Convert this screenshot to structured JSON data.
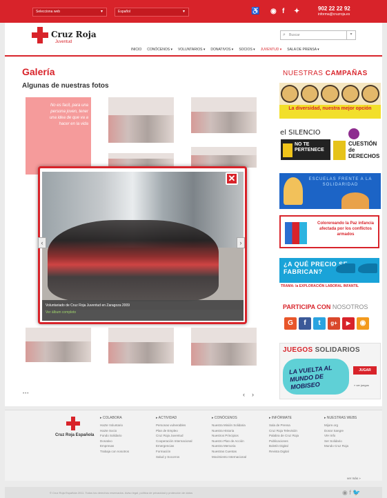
{
  "topbar": {
    "select_site": "Selecciona web",
    "select_lang": "Español",
    "phone": "902 22 22 92",
    "email": "informa@cruzroja.es",
    "icons": [
      "accessibility-icon",
      "rss-icon",
      "facebook-icon",
      "twitter-icon"
    ]
  },
  "header": {
    "brand": "Cruz Roja",
    "brand_sub": "Juventud",
    "search_placeholder": "Buscar",
    "nav": [
      "INICIO",
      "CONÓCENOS ▾",
      "VOLUNTARIOS ▾",
      "DONATIVOS ▾",
      "SOCIOS ▾",
      "JUVENTUD ▾",
      "SALA DE PRENSA ▾"
    ],
    "nav_active_index": 5
  },
  "gallery": {
    "title": "Galería",
    "subtitle": "Algunas de nuestras fotos",
    "red_thumb_text": "No es facil, para una persona joven, tener una idea de que va a hacer en la vida",
    "dots": "•••",
    "prev": "‹",
    "next": "›"
  },
  "lightbox": {
    "caption": "Voluntariado de Cruz Roja Juventud en Zaragoza 2009",
    "caption_link": "Ver álbum completo",
    "close": "✕",
    "prev": "‹",
    "next": "›"
  },
  "sidebar": {
    "campaigns_title_a": "NUESTRAS",
    "campaigns_title_b": "CAMPAÑAS",
    "banner1": "La diversidad, nuestra mejor opción",
    "banner2_a": "el SILENCIO",
    "banner2_b": "NO TE PERTENECE",
    "banner2_c": "CUESTIÓN de DERECHOS",
    "banner3": "ESCUELAS FRENTE A LA SOLIDARIDAD",
    "banner4": "Colorereando la Paz infancia afectada por los conflictos armados",
    "banner5_top": "¿A QUÉ PRECIO SE FABRICAN?",
    "banner5_bottom": "TRAMA: la EXPLORACIÓN LABORAL INFANTIL",
    "participa_a": "PARTICIPA CON",
    "participa_b": "NOSOTROS",
    "social": [
      {
        "name": "google-icon",
        "glyph": "G",
        "color": "#e8562a"
      },
      {
        "name": "facebook-icon",
        "glyph": "f",
        "color": "#3b5998"
      },
      {
        "name": "twitter-icon",
        "glyph": "t",
        "color": "#2aa3e0"
      },
      {
        "name": "googleplus-icon",
        "glyph": "g+",
        "color": "#d9482b"
      },
      {
        "name": "youtube-icon",
        "glyph": "▶",
        "color": "#d8232a"
      },
      {
        "name": "rss-icon",
        "glyph": "◉",
        "color": "#f39a1d"
      }
    ],
    "juegos_a": "JUEGOS",
    "juegos_b": "SOLIDARIOS",
    "juegos_art": "LA VUELTA AL MUNDO DE MOBISEO",
    "jugar": "JUGAR",
    "juegos_link": "» ver juegos"
  },
  "footer": {
    "logo": "Cruz Roja Española",
    "columns": [
      {
        "h": "▸ COLABORA",
        "items": [
          "Hazte Voluntario",
          "Hazte Socio",
          "Fondo Solidario",
          "Donativo",
          "Empresas",
          "Trabaja con nosotros"
        ]
      },
      {
        "h": "▸ ACTIVIDAD",
        "items": [
          "Personas vulnerables",
          "Plan de Empleo",
          "Cruz Roja Juventud",
          "Cooperación Internacional",
          "Emergencias",
          "Formación",
          "Salud y Socorros"
        ]
      },
      {
        "h": "▸ CONÓCENOS",
        "items": [
          "Nuestra Misión Solidaria",
          "Nuestra Historia",
          "Nuestros Principios",
          "Nuestro Plan de Acción",
          "Nuestra Memoria",
          "Nuestras Cuentas",
          "Movimiento Internacional"
        ]
      },
      {
        "h": "▸ INFÓRMATE",
        "items": [
          "Sala de Prensa",
          "Cruz Roja Televisión",
          "Palabra de Cruz Roja",
          "Publicaciones",
          "Boletín Digital",
          "Revista Digital"
        ]
      },
      {
        "h": "▸ NUESTRAS WEBS",
        "items": [
          "Mijore.org",
          "Donar Sangre",
          "VIH Info",
          "Ser Solidario",
          "Mundo Cruz Roja"
        ]
      }
    ],
    "more": "ver más »",
    "copyright": "© Cruz Roja Española 2011. Todos los derechos reservados. Aviso legal, política de privacidad y protección de datos",
    "bottom_icons": "◉ f 🐦"
  }
}
